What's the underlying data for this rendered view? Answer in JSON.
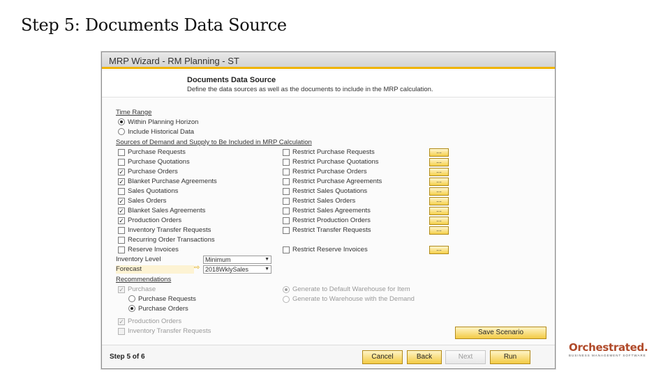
{
  "slide": {
    "title": "Step 5: Documents Data Source"
  },
  "window": {
    "title": "MRP Wizard - RM Planning - ST",
    "header_title": "Documents Data Source",
    "header_subtitle": "Define the data sources as well as the documents to include in the MRP calculation."
  },
  "time_range": {
    "heading": "Time Range",
    "options": [
      {
        "label": "Within Planning Horizon",
        "selected": true
      },
      {
        "label": "Include Historical Data",
        "selected": false
      }
    ]
  },
  "sources": {
    "heading": "Sources of Demand and Supply to Be Included in MRP Calculation",
    "dots_label": "...",
    "items": [
      {
        "label": "Purchase Requests",
        "checked": false
      },
      {
        "label": "Purchase Quotations",
        "checked": false
      },
      {
        "label": "Purchase Orders",
        "checked": true
      },
      {
        "label": "Blanket Purchase Agreements",
        "checked": true
      },
      {
        "label": "Sales Quotations",
        "checked": false
      },
      {
        "label": "Sales Orders",
        "checked": true
      },
      {
        "label": "Blanket Sales Agreements",
        "checked": true
      },
      {
        "label": "Production Orders",
        "checked": true
      },
      {
        "label": "Inventory Transfer Requests",
        "checked": false
      },
      {
        "label": "Recurring Order Transactions",
        "checked": false
      },
      {
        "label": "Reserve Invoices",
        "checked": false
      }
    ],
    "restrict": [
      {
        "label": "Restrict Purchase Requests",
        "checked": false
      },
      {
        "label": "Restrict Purchase Quotations",
        "checked": false
      },
      {
        "label": "Restrict Purchase Orders",
        "checked": false
      },
      {
        "label": "Restrict Purchase Agreements",
        "checked": false
      },
      {
        "label": "Restrict Sales Quotations",
        "checked": false
      },
      {
        "label": "Restrict Sales Orders",
        "checked": false
      },
      {
        "label": "Restrict Sales Agreements",
        "checked": false
      },
      {
        "label": "Restrict Production Orders",
        "checked": false
      },
      {
        "label": "Restrict Transfer Requests",
        "checked": false
      },
      {
        "label": "Restrict Reserve Invoices",
        "checked": false
      }
    ]
  },
  "inventory_level": {
    "label": "Inventory Level",
    "value": "Minimum"
  },
  "forecast": {
    "label": "Forecast",
    "value": "2018WklySales"
  },
  "recommendations": {
    "heading": "Recommendations",
    "purchase_label": "Purchase",
    "purchase_options": [
      {
        "label": "Purchase Requests",
        "selected": false
      },
      {
        "label": "Purchase Orders",
        "selected": true
      }
    ],
    "warehouse_options": [
      {
        "label": "Generate to Default Warehouse for Item",
        "selected": true
      },
      {
        "label": "Generate to Warehouse with the Demand",
        "selected": false
      }
    ],
    "production_orders_label": "Production Orders",
    "inventory_transfer_label": "Inventory Transfer Requests"
  },
  "buttons": {
    "save_scenario": "Save Scenario",
    "cancel": "Cancel",
    "back": "Back",
    "next": "Next",
    "run": "Run"
  },
  "footer": {
    "step": "Step 5 of 6"
  },
  "logo": {
    "name": "Orchestrated.",
    "tagline": "BUSINESS MANAGEMENT SOFTWARE"
  },
  "check_mark": "✓"
}
